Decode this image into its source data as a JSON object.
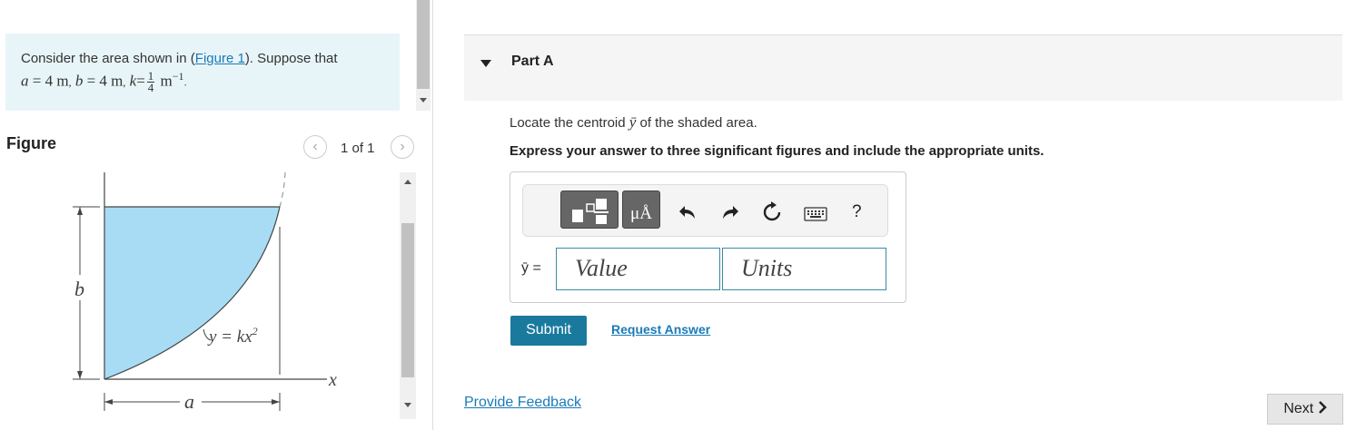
{
  "problem": {
    "text_prefix": "Consider the area shown in (",
    "figure_link": "Figure 1",
    "text_suffix": "). Suppose that",
    "a_var": "a",
    "a_val": "= 4",
    "a_unit": "m",
    "b_var": "b",
    "b_val": "= 4",
    "b_unit": "m",
    "k_var": "k",
    "k_eq": "=",
    "k_num": "1",
    "k_den": "4",
    "k_unit": "m",
    "k_exp": "−1",
    "comma": ",",
    "period": "."
  },
  "figure": {
    "title": "Figure",
    "page_indicator": "1 of 1",
    "prev_icon": "‹",
    "next_icon": "›",
    "label_b": "b",
    "label_a": "a",
    "label_x": "x",
    "curve_label": "y = kx",
    "curve_exp": "2"
  },
  "part": {
    "label": "Part A",
    "question_prefix": "Locate the centroid",
    "question_var": "ȳ",
    "question_suffix": "of the shaded area.",
    "instruction": "Express your answer to three significant figures and include the appropriate units."
  },
  "toolbar": {
    "mu_label": "μÅ",
    "help_label": "?"
  },
  "answer": {
    "ybar_label": "ȳ =",
    "value_placeholder": "Value",
    "units_placeholder": "Units"
  },
  "actions": {
    "submit": "Submit",
    "request": "Request Answer",
    "feedback": "Provide Feedback",
    "next": "Next"
  },
  "colors": {
    "accent": "#1a7a9e",
    "link": "#1a7bb8",
    "problem_bg": "#e8f5f8",
    "shaded_area": "#a8dcf5"
  }
}
